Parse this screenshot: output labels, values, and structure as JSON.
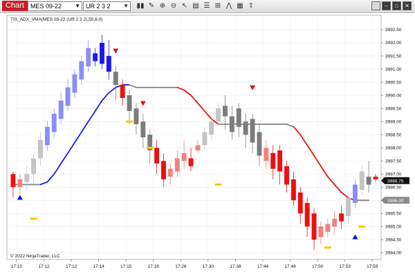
{
  "toolbar": {
    "window_label": "Chart",
    "instrument": "MES 09-22",
    "bar_type": "UR 2 3 2",
    "icons": [
      "bar-style-icon",
      "draw-icon",
      "zoom-in-icon",
      "zoom-out-icon",
      "pointer-icon",
      "data-box-icon",
      "properties-icon",
      "indicators-icon",
      "strategies-icon",
      "templates-icon",
      "share-icon"
    ]
  },
  "window_buttons": [
    "restore-icon",
    "minimize-icon",
    "maximize-icon",
    "close-icon"
  ],
  "indicator_label": "TIS_ADX_VMA(MES 09-22 (UR 2 3 2),50,6,0)",
  "copyright": "© 2022 NinjaTrader, LLC",
  "current_price_label": "3986.75",
  "vma_value_label": "3986.00",
  "chart_data": {
    "type": "candlestick",
    "y_axis_ticks": [
      "3992.50",
      "3992.00",
      "3991.50",
      "3991.00",
      "3990.50",
      "3990.00",
      "3989.50",
      "3989.00",
      "3988.50",
      "3988.00",
      "3987.50",
      "3987.00",
      "3986.50",
      "3986.00",
      "3985.50",
      "3985.00",
      "3984.50",
      "3984.00"
    ],
    "x_axis_ticks": [
      "17:10",
      "17:12",
      "17:12",
      "17:14",
      "17:15",
      "17:16",
      "17:26",
      "17:30",
      "17:38",
      "17:44",
      "17:48",
      "17:50",
      "17:53",
      "17:59"
    ],
    "ylim": [
      3983.8,
      3993.0
    ],
    "colors": {
      "up_light": "#8d8df8",
      "up_dark": "#1a1aee",
      "down_light": "#f28080",
      "down_dark": "#ee1010",
      "neutral_light": "#c4c4c4",
      "neutral_dark": "#7c7c7c",
      "vma_up": "#1a1aee",
      "vma_flat": "#808080",
      "vma_down": "#ee1010",
      "signal": "#f7c600"
    },
    "candles": [
      {
        "o": 3987.0,
        "h": 3987.1,
        "c": 3986.5,
        "l": 3986.1,
        "k": "down_dark"
      },
      {
        "o": 3986.8,
        "h": 3987.0,
        "c": 3986.5,
        "l": 3986.2,
        "k": "down_light"
      },
      {
        "o": 3986.7,
        "h": 3987.3,
        "c": 3987.0,
        "l": 3986.4,
        "k": "neutral_light"
      },
      {
        "o": 3987.0,
        "h": 3987.8,
        "c": 3987.6,
        "l": 3986.6,
        "k": "neutral_light"
      },
      {
        "o": 3987.6,
        "h": 3988.6,
        "c": 3988.3,
        "l": 3987.3,
        "k": "neutral_light"
      },
      {
        "o": 3988.1,
        "h": 3989.0,
        "c": 3988.8,
        "l": 3987.9,
        "k": "up_light"
      },
      {
        "o": 3988.6,
        "h": 3989.5,
        "c": 3989.3,
        "l": 3988.4,
        "k": "up_light"
      },
      {
        "o": 3989.1,
        "h": 3990.1,
        "c": 3989.8,
        "l": 3988.9,
        "k": "up_light"
      },
      {
        "o": 3989.6,
        "h": 3990.6,
        "c": 3990.3,
        "l": 3989.4,
        "k": "up_light"
      },
      {
        "o": 3990.1,
        "h": 3991.0,
        "c": 3990.8,
        "l": 3989.9,
        "k": "up_light"
      },
      {
        "o": 3990.6,
        "h": 3991.5,
        "c": 3991.3,
        "l": 3990.4,
        "k": "up_light"
      },
      {
        "o": 3991.1,
        "h": 3992.1,
        "c": 3991.8,
        "l": 3990.9,
        "k": "up_light"
      },
      {
        "o": 3991.3,
        "h": 3991.8,
        "c": 3991.6,
        "l": 3991.1,
        "k": "up_dark"
      },
      {
        "o": 3991.2,
        "h": 3992.3,
        "c": 3992.0,
        "l": 3991.0,
        "k": "up_dark"
      },
      {
        "o": 3991.5,
        "h": 3992.1,
        "c": 3990.9,
        "l": 3990.6,
        "k": "up_dark"
      },
      {
        "o": 3990.9,
        "h": 3991.1,
        "c": 3990.4,
        "l": 3989.8,
        "k": "neutral_dark"
      },
      {
        "o": 3990.4,
        "h": 3990.6,
        "c": 3989.9,
        "l": 3989.6,
        "k": "down_dark"
      },
      {
        "o": 3990.0,
        "h": 3990.2,
        "c": 3989.4,
        "l": 3988.9,
        "k": "neutral_dark"
      },
      {
        "o": 3989.5,
        "h": 3989.7,
        "c": 3988.9,
        "l": 3988.5,
        "k": "neutral_dark"
      },
      {
        "o": 3989.0,
        "h": 3989.3,
        "c": 3988.4,
        "l": 3988.0,
        "k": "neutral_dark"
      },
      {
        "o": 3988.5,
        "h": 3988.7,
        "c": 3987.9,
        "l": 3987.4,
        "k": "neutral_dark"
      },
      {
        "o": 3988.0,
        "h": 3988.3,
        "c": 3987.4,
        "l": 3987.0,
        "k": "down_dark"
      },
      {
        "o": 3987.5,
        "h": 3987.8,
        "c": 3986.8,
        "l": 3986.5,
        "k": "down_dark"
      },
      {
        "o": 3986.9,
        "h": 3987.4,
        "c": 3987.2,
        "l": 3986.6,
        "k": "down_light"
      },
      {
        "o": 3987.1,
        "h": 3987.9,
        "c": 3987.6,
        "l": 3986.9,
        "k": "down_light"
      },
      {
        "o": 3987.5,
        "h": 3988.3,
        "c": 3987.8,
        "l": 3987.2,
        "k": "down_light"
      },
      {
        "o": 3987.6,
        "h": 3988.0,
        "c": 3987.3,
        "l": 3987.1,
        "k": "down_dark"
      },
      {
        "o": 3987.9,
        "h": 3988.3,
        "c": 3988.1,
        "l": 3987.8,
        "k": "down_light"
      },
      {
        "o": 3988.1,
        "h": 3988.8,
        "c": 3988.6,
        "l": 3987.9,
        "k": "neutral_light"
      },
      {
        "o": 3988.5,
        "h": 3989.2,
        "c": 3989.0,
        "l": 3988.3,
        "k": "neutral_light"
      },
      {
        "o": 3989.0,
        "h": 3989.7,
        "c": 3989.5,
        "l": 3988.8,
        "k": "neutral_light"
      },
      {
        "o": 3989.6,
        "h": 3990.0,
        "c": 3989.2,
        "l": 3988.7,
        "k": "neutral_dark"
      },
      {
        "o": 3989.2,
        "h": 3989.6,
        "c": 3988.6,
        "l": 3988.3,
        "k": "neutral_dark"
      },
      {
        "o": 3989.5,
        "h": 3989.7,
        "c": 3988.8,
        "l": 3988.4,
        "k": "neutral_dark"
      },
      {
        "o": 3989.0,
        "h": 3989.3,
        "c": 3988.5,
        "l": 3988.0,
        "k": "neutral_dark"
      },
      {
        "o": 3989.1,
        "h": 3989.3,
        "c": 3988.2,
        "l": 3987.8,
        "k": "neutral_dark"
      },
      {
        "o": 3988.6,
        "h": 3988.9,
        "c": 3987.7,
        "l": 3987.3,
        "k": "neutral_dark"
      },
      {
        "o": 3988.0,
        "h": 3988.3,
        "c": 3987.5,
        "l": 3987.2,
        "k": "down_light"
      },
      {
        "o": 3987.8,
        "h": 3988.1,
        "c": 3987.2,
        "l": 3986.8,
        "k": "down_dark"
      },
      {
        "o": 3987.9,
        "h": 3988.1,
        "c": 3987.1,
        "l": 3986.6,
        "k": "down_dark"
      },
      {
        "o": 3987.3,
        "h": 3987.5,
        "c": 3986.6,
        "l": 3986.3,
        "k": "down_dark"
      },
      {
        "o": 3986.8,
        "h": 3987.1,
        "c": 3986.0,
        "l": 3985.8,
        "k": "down_dark"
      },
      {
        "o": 3986.3,
        "h": 3986.5,
        "c": 3985.5,
        "l": 3985.1,
        "k": "down_dark"
      },
      {
        "o": 3985.9,
        "h": 3986.1,
        "c": 3985.0,
        "l": 3984.6,
        "k": "down_dark"
      },
      {
        "o": 3985.5,
        "h": 3985.7,
        "c": 3984.5,
        "l": 3984.1,
        "k": "down_dark"
      },
      {
        "o": 3985.0,
        "h": 3985.2,
        "c": 3984.6,
        "l": 3984.3,
        "k": "down_light"
      },
      {
        "o": 3984.8,
        "h": 3985.3,
        "c": 3985.1,
        "l": 3984.6,
        "k": "down_light"
      },
      {
        "o": 3985.0,
        "h": 3985.6,
        "c": 3985.3,
        "l": 3984.7,
        "k": "down_light"
      },
      {
        "o": 3985.2,
        "h": 3985.8,
        "c": 3985.5,
        "l": 3984.9,
        "k": "down_dark"
      },
      {
        "o": 3985.4,
        "h": 3986.3,
        "c": 3986.1,
        "l": 3985.1,
        "k": "neutral_light"
      },
      {
        "o": 3985.9,
        "h": 3986.8,
        "c": 3986.6,
        "l": 3985.7,
        "k": "up_light"
      },
      {
        "o": 3986.4,
        "h": 3987.3,
        "c": 3987.1,
        "l": 3986.2,
        "k": "neutral_light"
      },
      {
        "o": 3986.9,
        "h": 3987.5,
        "c": 3986.6,
        "l": 3986.3,
        "k": "neutral_dark"
      },
      {
        "o": 3986.8,
        "h": 3987.0,
        "c": 3986.9,
        "l": 3986.7,
        "k": "down_dark"
      }
    ],
    "vma": [
      3986.6,
      3986.6,
      3986.6,
      3986.6,
      3986.6,
      3986.7,
      3987.0,
      3987.4,
      3987.8,
      3988.2,
      3988.6,
      3989.0,
      3989.4,
      3989.8,
      3990.1,
      3990.3,
      3990.4,
      3990.4,
      3990.3,
      3990.3,
      3990.3,
      3990.3,
      3990.3,
      3990.3,
      3990.3,
      3990.2,
      3990.0,
      3989.7,
      3989.4,
      3989.1,
      3988.9,
      3988.9,
      3988.9,
      3988.9,
      3988.9,
      3988.9,
      3988.9,
      3988.9,
      3988.9,
      3988.9,
      3988.9,
      3988.8,
      3988.5,
      3988.1,
      3987.7,
      3987.3,
      3986.9,
      3986.6,
      3986.3,
      3986.1,
      3986.0,
      3986.0,
      3986.0
    ],
    "vma_state": [
      "flat",
      "flat",
      "flat",
      "flat",
      "up",
      "up",
      "up",
      "up",
      "up",
      "up",
      "up",
      "up",
      "up",
      "up",
      "up",
      "up",
      "up",
      "flat",
      "flat",
      "flat",
      "flat",
      "flat",
      "flat",
      "flat",
      "down",
      "down",
      "down",
      "down",
      "down",
      "down",
      "flat",
      "flat",
      "flat",
      "flat",
      "flat",
      "flat",
      "flat",
      "flat",
      "flat",
      "flat",
      "flat",
      "down",
      "down",
      "down",
      "down",
      "down",
      "down",
      "down",
      "down",
      "down",
      "flat",
      "flat",
      "flat"
    ],
    "triangles_down": [
      {
        "i": 15,
        "y": 3991.7
      },
      {
        "i": 19,
        "y": 3989.7
      },
      {
        "i": 35,
        "y": 3990.3
      }
    ],
    "triangles_up": [
      {
        "i": 1,
        "y": 3986.1
      },
      {
        "i": 50,
        "y": 3984.6
      }
    ],
    "signal_dashes": [
      {
        "i": 3,
        "y": 3985.3
      },
      {
        "i": 17,
        "y": 3989.0
      },
      {
        "i": 20,
        "y": 3988.0
      },
      {
        "i": 30,
        "y": 3986.6
      },
      {
        "i": 46,
        "y": 3984.2
      },
      {
        "i": 51,
        "y": 3985.0
      }
    ]
  }
}
